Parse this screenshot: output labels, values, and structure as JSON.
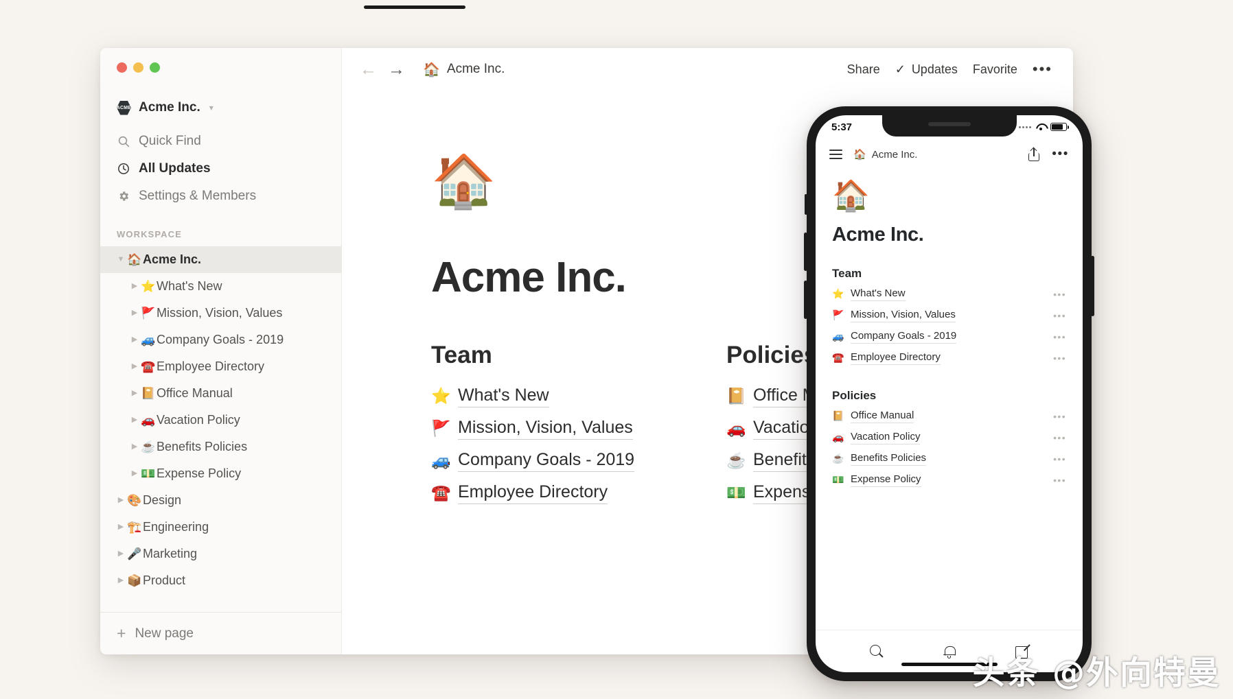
{
  "window": {
    "traffic_lights": [
      "close",
      "minimize",
      "maximize"
    ],
    "workspace_switcher": {
      "logo_text": "ACME",
      "name": "Acme Inc."
    },
    "nav": [
      {
        "icon": "search-icon",
        "glyph": "⌕",
        "label": "Quick Find",
        "strong": false
      },
      {
        "icon": "clock-icon",
        "glyph": "◴",
        "label": "All Updates",
        "strong": true
      },
      {
        "icon": "gear-icon",
        "glyph": "⚙",
        "label": "Settings & Members",
        "strong": false
      }
    ],
    "section_label": "WORKSPACE",
    "tree": [
      {
        "level": 0,
        "arrow": "▼",
        "emoji": "🏠",
        "label": "Acme Inc.",
        "selected": true,
        "sub": false
      },
      {
        "level": 1,
        "arrow": "▶",
        "emoji": "⭐",
        "label": "What's New",
        "selected": false,
        "sub": false
      },
      {
        "level": 1,
        "arrow": "▶",
        "emoji": "🚩",
        "label": "Mission, Vision, Values",
        "selected": false,
        "sub": false
      },
      {
        "level": 1,
        "arrow": "▶",
        "emoji": "🚙",
        "label": "Company Goals - 2019",
        "selected": false,
        "sub": false
      },
      {
        "level": 1,
        "arrow": "▶",
        "emoji": "☎️",
        "label": "Employee Directory",
        "selected": false,
        "sub": false
      },
      {
        "level": 1,
        "arrow": "▶",
        "emoji": "📔",
        "label": "Office Manual",
        "selected": false,
        "sub": false
      },
      {
        "level": 1,
        "arrow": "▶",
        "emoji": "🚗",
        "label": "Vacation Policy",
        "selected": false,
        "sub": false
      },
      {
        "level": 1,
        "arrow": "▶",
        "emoji": "☕",
        "label": "Benefits Policies",
        "selected": false,
        "sub": false
      },
      {
        "level": 1,
        "arrow": "▶",
        "emoji": "💵",
        "label": "Expense Policy",
        "selected": false,
        "sub": false
      },
      {
        "level": 0,
        "arrow": "▶",
        "emoji": "🎨",
        "label": "Design",
        "selected": false,
        "sub": true
      },
      {
        "level": 0,
        "arrow": "▶",
        "emoji": "🏗️",
        "label": "Engineering",
        "selected": false,
        "sub": true
      },
      {
        "level": 0,
        "arrow": "▶",
        "emoji": "🎤",
        "label": "Marketing",
        "selected": false,
        "sub": true
      },
      {
        "level": 0,
        "arrow": "▶",
        "emoji": "📦",
        "label": "Product",
        "selected": false,
        "sub": true
      }
    ],
    "new_page": {
      "glyph": "+",
      "label": "New page"
    }
  },
  "toolbar": {
    "back_glyph": "←",
    "forward_glyph": "→",
    "breadcrumb_emoji": "🏠",
    "breadcrumb_label": "Acme Inc.",
    "share_label": "Share",
    "check_glyph": "✓",
    "updates_label": "Updates",
    "favorite_label": "Favorite",
    "more_glyph": "•••"
  },
  "page": {
    "emoji": "🏠",
    "title": "Acme Inc.",
    "columns": [
      {
        "heading": "Team",
        "links": [
          {
            "emoji": "⭐",
            "label": "What's New"
          },
          {
            "emoji": "🚩",
            "label": "Mission, Vision, Values"
          },
          {
            "emoji": "🚙",
            "label": "Company Goals - 2019"
          },
          {
            "emoji": "☎️",
            "label": "Employee Directory"
          }
        ]
      },
      {
        "heading": "Policies",
        "links": [
          {
            "emoji": "📔",
            "label": "Office Manual"
          },
          {
            "emoji": "🚗",
            "label": "Vacation Policy"
          },
          {
            "emoji": "☕",
            "label": "Benefits Policies"
          },
          {
            "emoji": "💵",
            "label": "Expense Policy"
          }
        ]
      }
    ]
  },
  "phone": {
    "status": {
      "time": "5:37",
      "signal": "signal-dots-icon",
      "wifi": "wifi-icon",
      "battery": "battery-icon"
    },
    "header": {
      "menu_glyph": "hamburger-icon",
      "breadcrumb_emoji": "🏠",
      "breadcrumb_label": "Acme Inc.",
      "share": "share-icon",
      "more_glyph": "•••"
    },
    "content": {
      "emoji": "🏠",
      "title": "Acme Inc.",
      "sections": [
        {
          "heading": "Team",
          "items": [
            {
              "emoji": "⭐",
              "label": "What's New",
              "more": "•••"
            },
            {
              "emoji": "🚩",
              "label": "Mission, Vision, Values",
              "more": "•••"
            },
            {
              "emoji": "🚙",
              "label": "Company Goals - 2019",
              "more": "•••"
            },
            {
              "emoji": "☎️",
              "label": "Employee Directory",
              "more": "•••"
            }
          ]
        },
        {
          "heading": "Policies",
          "items": [
            {
              "emoji": "📔",
              "label": "Office Manual",
              "more": "•••"
            },
            {
              "emoji": "🚗",
              "label": "Vacation Policy",
              "more": "•••"
            },
            {
              "emoji": "☕",
              "label": "Benefits Policies",
              "more": "•••"
            },
            {
              "emoji": "💵",
              "label": "Expense Policy",
              "more": "•••"
            }
          ]
        }
      ]
    },
    "tabs": [
      {
        "icon": "search-icon"
      },
      {
        "icon": "bell-icon"
      },
      {
        "icon": "compose-icon"
      }
    ]
  },
  "watermark": "头条 @外向特曼",
  "colors": {
    "canvas": "#f7f4f0",
    "sidebar": "#fbfaf9",
    "selected_row": "#ebe9e6",
    "text_primary": "#2c2c2c",
    "text_muted": "#7d7a76"
  }
}
